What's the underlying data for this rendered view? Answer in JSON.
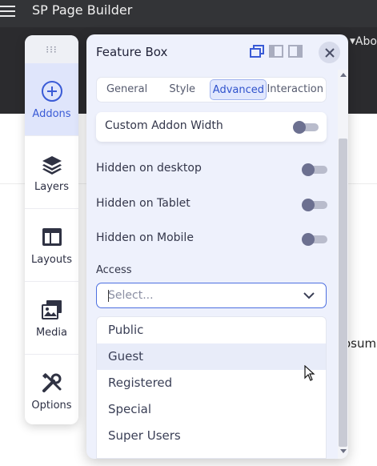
{
  "app": {
    "title": "SP Page Builder",
    "nav_about": "Abo"
  },
  "background": {
    "partial_text": "osum"
  },
  "dock": {
    "items": [
      {
        "label": "Addons",
        "icon": "plus-circle-icon",
        "active": true
      },
      {
        "label": "Layers",
        "icon": "layers-icon",
        "active": false
      },
      {
        "label": "Layouts",
        "icon": "layout-icon",
        "active": false
      },
      {
        "label": "Media",
        "icon": "media-icon",
        "active": false
      },
      {
        "label": "Options",
        "icon": "tools-icon",
        "active": false
      }
    ]
  },
  "panel": {
    "title": "Feature Box",
    "tabs": [
      {
        "label": "General",
        "active": false
      },
      {
        "label": "Style",
        "active": false
      },
      {
        "label": "Advanced",
        "active": true
      },
      {
        "label": "Interaction",
        "active": false
      }
    ],
    "fields": {
      "custom_width": {
        "label": "Custom Addon Width",
        "on": false
      },
      "hidden_desktop": {
        "label": "Hidden on desktop",
        "on": false
      },
      "hidden_tablet": {
        "label": "Hidden on Tablet",
        "on": false
      },
      "hidden_mobile": {
        "label": "Hidden on Mobile",
        "on": false
      }
    },
    "access": {
      "label": "Access",
      "placeholder": "Select...",
      "options": [
        "Public",
        "Guest",
        "Registered",
        "Special",
        "Super Users"
      ],
      "hovered": "Guest"
    }
  },
  "colors": {
    "accent": "#3a5bd6",
    "panel_bg": "#eef1fc",
    "topbar": "#333437"
  }
}
